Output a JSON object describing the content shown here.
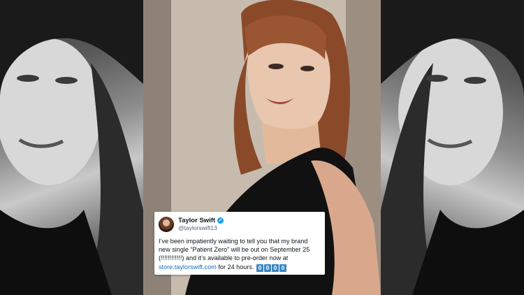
{
  "tweet": {
    "display_name": "Taylor Swift",
    "verified_icon": "verified-check-icon",
    "handle": "@taylorswift13",
    "text_line1": "I’ve been impatiently waiting to tell you that my brand",
    "text_line2": "new single “Patient Zero” will be out on September 25",
    "text_line3": "(!!!!!!!!!!!!) and it’s available to pre-order now at",
    "link": "store.taylorswift.com",
    "text_after_link": " for 24 hours.",
    "emoji_boxes": [
      "0",
      "0",
      "0",
      "0"
    ]
  },
  "colors": {
    "verified_blue": "#1d9bf0",
    "link_blue": "#1d6fb8",
    "emoji_blue": "#3b88c3"
  }
}
